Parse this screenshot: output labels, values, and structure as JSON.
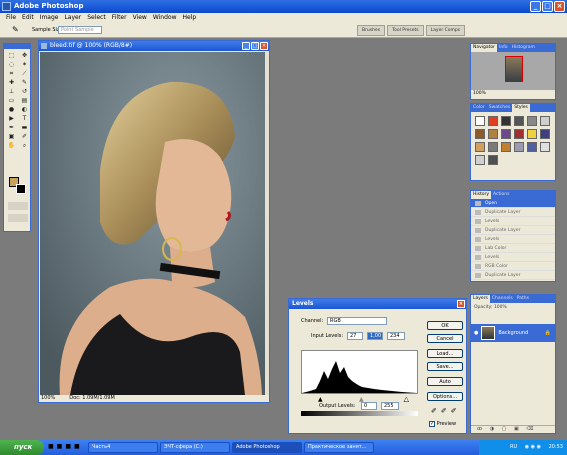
{
  "app": {
    "title": "Adobe Photoshop"
  },
  "menu": [
    "File",
    "Edit",
    "Image",
    "Layer",
    "Select",
    "Filter",
    "View",
    "Window",
    "Help"
  ],
  "options": {
    "sample_label": "Sample Size:",
    "sample_value": "Point Sample"
  },
  "well_tabs": [
    "Brushes",
    "Tool Presets",
    "Layer Comps"
  ],
  "document": {
    "title": "bleed.tif @ 100% (RGB/8#)",
    "zoom": "100%",
    "doc_size": "Doc: 1.09M/1.09M"
  },
  "navigator": {
    "tabs": [
      "Navigator",
      "Info",
      "Histogram"
    ],
    "zoom": "100%"
  },
  "styles": {
    "tabs": [
      "Color",
      "Swatches",
      "Styles"
    ]
  },
  "history": {
    "tabs": [
      "History",
      "Actions"
    ],
    "items": [
      {
        "label": "Open",
        "state": "selected"
      },
      {
        "label": "Duplicate Layer",
        "state": "inactive"
      },
      {
        "label": "Levels",
        "state": "inactive"
      },
      {
        "label": "Duplicate Layer",
        "state": "inactive"
      },
      {
        "label": "Levels",
        "state": "inactive"
      },
      {
        "label": "Lab Color",
        "state": "inactive"
      },
      {
        "label": "Levels",
        "state": "inactive"
      },
      {
        "label": "RGB Color",
        "state": "inactive"
      },
      {
        "label": "Duplicate Layer",
        "state": "inactive"
      }
    ]
  },
  "layers": {
    "tabs": [
      "Layers",
      "Channels",
      "Paths"
    ],
    "opacity_label": "Opacity:",
    "opacity_value": "100%",
    "layer_name": "Background"
  },
  "levels": {
    "title": "Levels",
    "channel_label": "Channel:",
    "channel_value": "RGB",
    "input_label": "Input Levels:",
    "input_black": "27",
    "input_gamma": "1,00",
    "input_white": "234",
    "output_label": "Output Levels:",
    "output_black": "0",
    "output_white": "255",
    "buttons": [
      "OK",
      "Cancel",
      "Load...",
      "Save...",
      "Auto",
      "Options..."
    ],
    "preview_label": "Preview"
  },
  "taskbar": {
    "start": "пуск",
    "buttons": [
      "Часть4",
      "ЭЧТ-сфера (С:)",
      "Adobe Photoshop",
      "Практическое занят..."
    ],
    "lang": "RU",
    "time": "20:53"
  },
  "colors": {
    "accent": "#3a6ad4",
    "workspace": "#7b7b7b",
    "taskbar": "#245edb"
  }
}
